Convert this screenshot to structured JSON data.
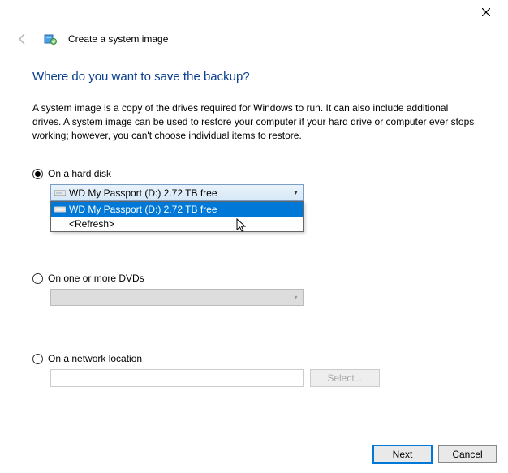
{
  "title": "Create a system image",
  "heading": "Where do you want to save the backup?",
  "description": "A system image is a copy of the drives required for Windows to run. It can also include additional drives. A system image can be used to restore your computer if your hard drive or computer ever stops working; however, you can't choose individual items to restore.",
  "options": {
    "hard_disk": {
      "label": "On a hard disk",
      "selected_value": "WD My Passport (D:)  2.72 TB free",
      "dropdown_items": [
        {
          "label": "WD My Passport (D:)  2.72 TB free",
          "selected": true
        },
        {
          "label": "<Refresh>",
          "selected": false
        }
      ]
    },
    "dvds": {
      "label": "On one or more DVDs"
    },
    "network": {
      "label": "On a network location",
      "select_button": "Select..."
    }
  },
  "footer": {
    "next": "Next",
    "cancel": "Cancel"
  }
}
